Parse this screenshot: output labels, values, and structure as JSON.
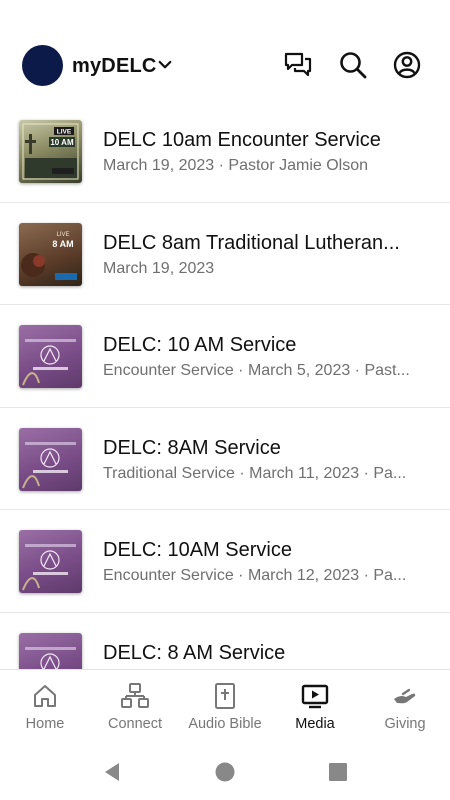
{
  "header": {
    "title": "myDELC",
    "icons": [
      "chat-icon",
      "search-icon",
      "account-icon"
    ]
  },
  "media_items": [
    {
      "title": "DELC 10am Encounter Service",
      "subtitle": "March 19, 2023 · Pastor Jamie Olson",
      "thumb_text": "LIVE 10 AM"
    },
    {
      "title": "DELC 8am Traditional Lutheran...",
      "subtitle": "March 19, 2023",
      "thumb_text": "LIVE 8 AM"
    },
    {
      "title": "DELC: 10 AM Service",
      "subtitle": "Encounter Service · March 5, 2023 · Past...",
      "thumb_text": "DANNEBROG LUTHERAN CHURCH"
    },
    {
      "title": "DELC: 8AM Service",
      "subtitle": "Traditional Service · March 11, 2023 · Pa...",
      "thumb_text": "DANNEBROG LUTHERAN CHURCH"
    },
    {
      "title": "DELC: 10AM Service",
      "subtitle": "Encounter Service · March 12, 2023 · Pa...",
      "thumb_text": "DANNEBROG LUTHERAN CHURCH"
    },
    {
      "title": "DELC: 8 AM Service",
      "subtitle": "",
      "thumb_text": "DANNEBROG LUTHERAN CHURCH"
    }
  ],
  "tabs": [
    {
      "label": "Home",
      "icon": "home-icon",
      "active": false
    },
    {
      "label": "Connect",
      "icon": "connect-icon",
      "active": false
    },
    {
      "label": "Audio Bible",
      "icon": "bible-icon",
      "active": false
    },
    {
      "label": "Media",
      "icon": "media-icon",
      "active": true
    },
    {
      "label": "Giving",
      "icon": "giving-icon",
      "active": false
    }
  ],
  "colors": {
    "avatar": "#0c1a4a",
    "active_tab": "#111111",
    "inactive_tab": "#777777"
  }
}
